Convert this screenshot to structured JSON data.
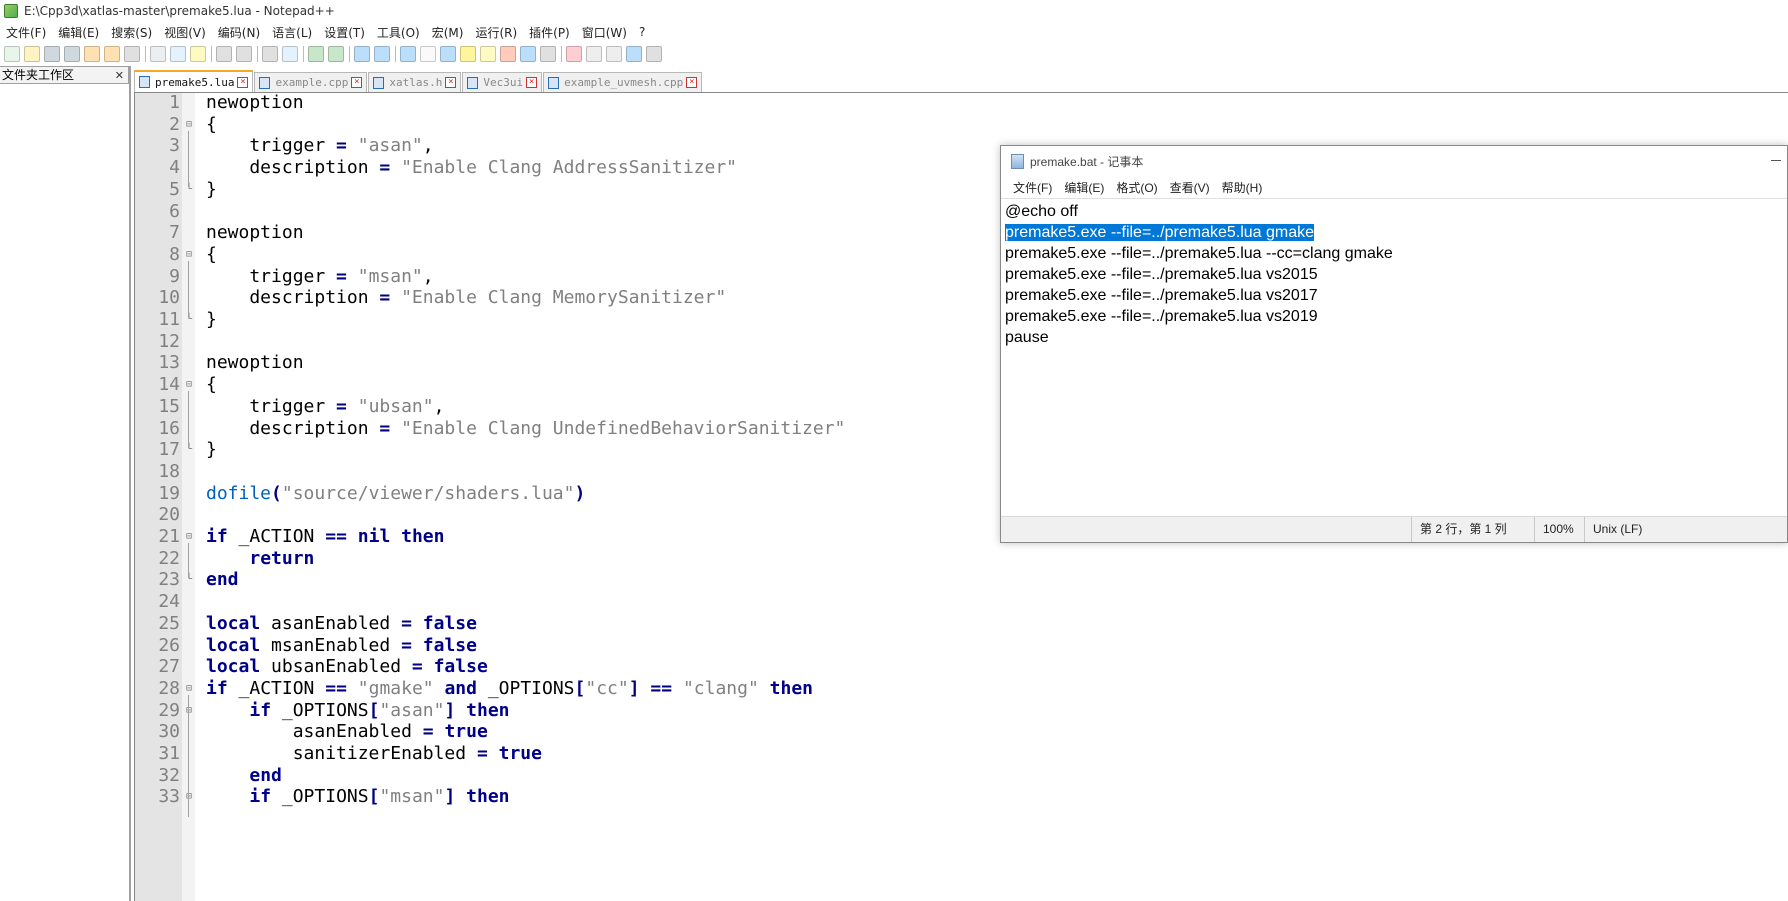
{
  "window": {
    "title": "E:\\Cpp3d\\xatlas-master\\premake5.lua - Notepad++"
  },
  "menu": [
    "文件(F)",
    "编辑(E)",
    "搜索(S)",
    "视图(V)",
    "编码(N)",
    "语言(L)",
    "设置(T)",
    "工具(O)",
    "宏(M)",
    "运行(R)",
    "插件(P)",
    "窗口(W)",
    "?"
  ],
  "toolbar_icons": [
    "new-file-icon",
    "open-file-icon",
    "save-icon",
    "save-all-icon",
    "close-icon",
    "close-all-icon",
    "print-icon",
    "cut-icon",
    "copy-icon",
    "paste-icon",
    "undo-icon",
    "redo-icon",
    "find-icon",
    "replace-icon",
    "zoom-in-icon",
    "zoom-out-icon",
    "sync-v-icon",
    "sync-h-icon",
    "word-wrap-icon",
    "show-all-chars-icon",
    "indent-guide-icon",
    "user-lang-icon",
    "doc-map-icon",
    "function-list-icon",
    "folder-workspace-icon",
    "monitor-icon",
    "record-macro-icon",
    "stop-macro-icon",
    "play-macro-icon",
    "run-macro-multiple-icon",
    "save-macro-icon"
  ],
  "file_panel": {
    "title": "文件夹工作区"
  },
  "tabs": [
    {
      "label": "premake5.lua",
      "active": true
    },
    {
      "label": "example.cpp",
      "active": false
    },
    {
      "label": "xatlas.h",
      "active": false
    },
    {
      "label": "Vec3ui",
      "active": false
    },
    {
      "label": "example_uvmesh.cpp",
      "active": false
    }
  ],
  "editor": {
    "lines": [
      {
        "n": "1",
        "fold": "",
        "code": [
          [
            "",
            "newoption"
          ]
        ]
      },
      {
        "n": "2",
        "fold": "⊟",
        "code": [
          [
            "",
            "{"
          ]
        ]
      },
      {
        "n": "3",
        "fold": "",
        "code": [
          [
            "",
            "    trigger "
          ],
          [
            "op",
            "="
          ],
          [
            "",
            " "
          ],
          [
            "str",
            "\"asan\""
          ],
          [
            "",
            ","
          ]
        ]
      },
      {
        "n": "4",
        "fold": "",
        "code": [
          [
            "",
            "    description "
          ],
          [
            "op",
            "="
          ],
          [
            "",
            " "
          ],
          [
            "str",
            "\"Enable Clang AddressSanitizer\""
          ]
        ]
      },
      {
        "n": "5",
        "fold": "└",
        "code": [
          [
            "",
            "}"
          ]
        ]
      },
      {
        "n": "6",
        "fold": "",
        "code": [
          [
            "",
            ""
          ]
        ]
      },
      {
        "n": "7",
        "fold": "",
        "code": [
          [
            "",
            "newoption"
          ]
        ]
      },
      {
        "n": "8",
        "fold": "⊟",
        "code": [
          [
            "",
            "{"
          ]
        ]
      },
      {
        "n": "9",
        "fold": "",
        "code": [
          [
            "",
            "    trigger "
          ],
          [
            "op",
            "="
          ],
          [
            "",
            " "
          ],
          [
            "str",
            "\"msan\""
          ],
          [
            "",
            ","
          ]
        ]
      },
      {
        "n": "10",
        "fold": "",
        "code": [
          [
            "",
            "    description "
          ],
          [
            "op",
            "="
          ],
          [
            "",
            " "
          ],
          [
            "str",
            "\"Enable Clang MemorySanitizer\""
          ]
        ]
      },
      {
        "n": "11",
        "fold": "└",
        "code": [
          [
            "",
            "}"
          ]
        ]
      },
      {
        "n": "12",
        "fold": "",
        "code": [
          [
            "",
            ""
          ]
        ]
      },
      {
        "n": "13",
        "fold": "",
        "code": [
          [
            "",
            "newoption"
          ]
        ]
      },
      {
        "n": "14",
        "fold": "⊟",
        "code": [
          [
            "",
            "{"
          ]
        ]
      },
      {
        "n": "15",
        "fold": "",
        "code": [
          [
            "",
            "    trigger "
          ],
          [
            "op",
            "="
          ],
          [
            "",
            " "
          ],
          [
            "str",
            "\"ubsan\""
          ],
          [
            "",
            ","
          ]
        ]
      },
      {
        "n": "16",
        "fold": "",
        "code": [
          [
            "",
            "    description "
          ],
          [
            "op",
            "="
          ],
          [
            "",
            " "
          ],
          [
            "str",
            "\"Enable Clang UndefinedBehaviorSanitizer\""
          ]
        ]
      },
      {
        "n": "17",
        "fold": "└",
        "code": [
          [
            "",
            "}"
          ]
        ]
      },
      {
        "n": "18",
        "fold": "",
        "code": [
          [
            "",
            ""
          ]
        ]
      },
      {
        "n": "19",
        "fold": "",
        "code": [
          [
            "fn",
            "dofile"
          ],
          [
            "op",
            "("
          ],
          [
            "str",
            "\"source/viewer/shaders.lua\""
          ],
          [
            "op",
            ")"
          ]
        ]
      },
      {
        "n": "20",
        "fold": "",
        "code": [
          [
            "",
            ""
          ]
        ]
      },
      {
        "n": "21",
        "fold": "⊟",
        "code": [
          [
            "kw",
            "if"
          ],
          [
            "",
            " _ACTION "
          ],
          [
            "op",
            "=="
          ],
          [
            "",
            " "
          ],
          [
            "kw",
            "nil"
          ],
          [
            "",
            " "
          ],
          [
            "kw",
            "then"
          ]
        ]
      },
      {
        "n": "22",
        "fold": "",
        "code": [
          [
            "",
            "    "
          ],
          [
            "kw",
            "return"
          ]
        ]
      },
      {
        "n": "23",
        "fold": "└",
        "code": [
          [
            "kw",
            "end"
          ]
        ]
      },
      {
        "n": "24",
        "fold": "",
        "code": [
          [
            "",
            ""
          ]
        ]
      },
      {
        "n": "25",
        "fold": "",
        "code": [
          [
            "kw",
            "local"
          ],
          [
            "",
            " asanEnabled "
          ],
          [
            "op",
            "="
          ],
          [
            "",
            " "
          ],
          [
            "kw",
            "false"
          ]
        ]
      },
      {
        "n": "26",
        "fold": "",
        "code": [
          [
            "kw",
            "local"
          ],
          [
            "",
            " msanEnabled "
          ],
          [
            "op",
            "="
          ],
          [
            "",
            " "
          ],
          [
            "kw",
            "false"
          ]
        ]
      },
      {
        "n": "27",
        "fold": "",
        "code": [
          [
            "kw",
            "local"
          ],
          [
            "",
            " ubsanEnabled "
          ],
          [
            "op",
            "="
          ],
          [
            "",
            " "
          ],
          [
            "kw",
            "false"
          ]
        ]
      },
      {
        "n": "28",
        "fold": "⊟",
        "code": [
          [
            "kw",
            "if"
          ],
          [
            "",
            " _ACTION "
          ],
          [
            "op",
            "=="
          ],
          [
            "",
            " "
          ],
          [
            "str",
            "\"gmake\""
          ],
          [
            "",
            " "
          ],
          [
            "kw",
            "and"
          ],
          [
            "",
            " _OPTIONS"
          ],
          [
            "op",
            "["
          ],
          [
            "str",
            "\"cc\""
          ],
          [
            "op",
            "]"
          ],
          [
            "",
            " "
          ],
          [
            "op",
            "=="
          ],
          [
            "",
            " "
          ],
          [
            "str",
            "\"clang\""
          ],
          [
            "",
            " "
          ],
          [
            "kw",
            "then"
          ]
        ]
      },
      {
        "n": "29",
        "fold": "⊟",
        "code": [
          [
            "",
            "    "
          ],
          [
            "kw",
            "if"
          ],
          [
            "",
            " _OPTIONS"
          ],
          [
            "op",
            "["
          ],
          [
            "str",
            "\"asan\""
          ],
          [
            "op",
            "]"
          ],
          [
            "",
            " "
          ],
          [
            "kw",
            "then"
          ]
        ]
      },
      {
        "n": "30",
        "fold": "",
        "code": [
          [
            "",
            "        asanEnabled "
          ],
          [
            "op",
            "="
          ],
          [
            "",
            " "
          ],
          [
            "kw",
            "true"
          ]
        ]
      },
      {
        "n": "31",
        "fold": "",
        "code": [
          [
            "",
            "        sanitizerEnabled "
          ],
          [
            "op",
            "="
          ],
          [
            "",
            " "
          ],
          [
            "kw",
            "true"
          ]
        ]
      },
      {
        "n": "32",
        "fold": "",
        "code": [
          [
            "",
            "    "
          ],
          [
            "kw",
            "end"
          ]
        ]
      },
      {
        "n": "33",
        "fold": "⊟",
        "code": [
          [
            "",
            "    "
          ],
          [
            "kw",
            "if"
          ],
          [
            "",
            " _OPTIONS"
          ],
          [
            "op",
            "["
          ],
          [
            "str",
            "\"msan\""
          ],
          [
            "op",
            "]"
          ],
          [
            "",
            " "
          ],
          [
            "kw",
            "then"
          ]
        ]
      }
    ]
  },
  "notepad": {
    "title": "premake.bat - 记事本",
    "menu": [
      "文件(F)",
      "编辑(E)",
      "格式(O)",
      "查看(V)",
      "帮助(H)"
    ],
    "lines": [
      {
        "text": "@echo off",
        "selected": false
      },
      {
        "text": "premake5.exe --file=../premake5.lua gmake",
        "selected": true
      },
      {
        "text": "premake5.exe --file=../premake5.lua --cc=clang gmake",
        "selected": false
      },
      {
        "text": "premake5.exe --file=../premake5.lua vs2015",
        "selected": false
      },
      {
        "text": "premake5.exe --file=../premake5.lua vs2017",
        "selected": false
      },
      {
        "text": "premake5.exe --file=../premake5.lua vs2019",
        "selected": false
      },
      {
        "text": "pause",
        "selected": false
      }
    ],
    "status": {
      "position": "第 2 行，第 1 列",
      "zoom": "100%",
      "eol": "Unix (LF)"
    }
  },
  "colors": {
    "keyword": "#00008b",
    "string": "#808080",
    "function": "#0060c0",
    "selection": "#0078d7",
    "active_tab_accent": "#f9a825"
  }
}
